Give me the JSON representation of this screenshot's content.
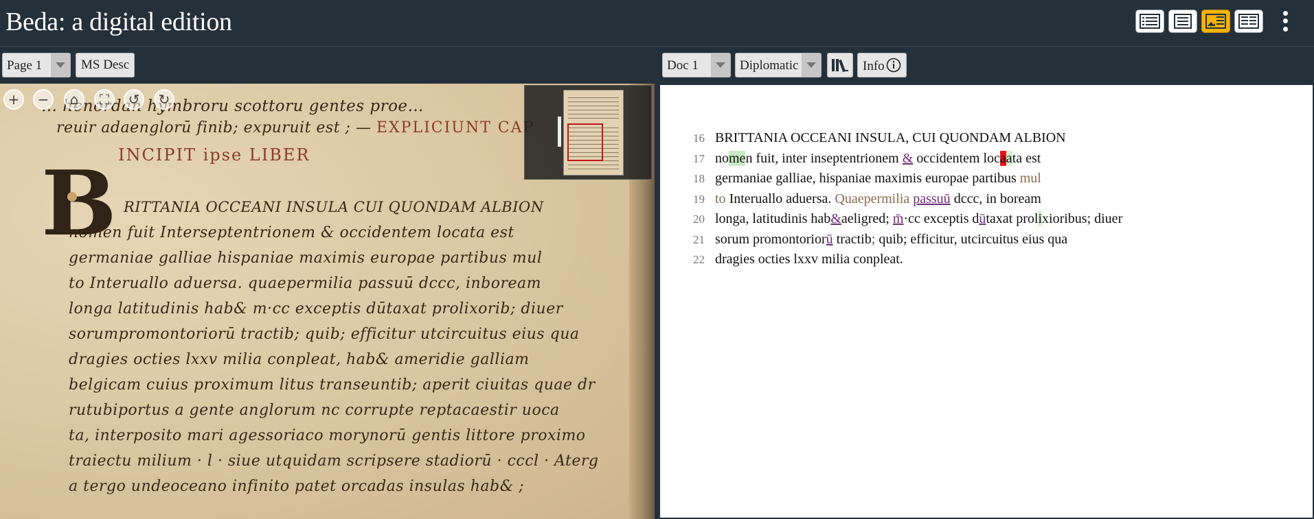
{
  "header": {
    "title": "Beda: a digital edition",
    "views": [
      {
        "name": "toc-view",
        "icon": "list-icon",
        "active": false
      },
      {
        "name": "text-view",
        "icon": "text-icon",
        "active": false
      },
      {
        "name": "image-text-view",
        "icon": "image-text-icon",
        "active": true
      },
      {
        "name": "text-text-view",
        "icon": "text-text-icon",
        "active": false
      }
    ],
    "more_icon": "kebab-menu-icon",
    "accent": "#f5b40a"
  },
  "left_toolbar": {
    "page_select": "Page 1",
    "ms_desc": "MS Desc"
  },
  "right_toolbar": {
    "doc_select": "Doc 1",
    "edition_select": "Diplomatic",
    "library_icon": "library-books-icon",
    "info_label": "Info",
    "info_icon": "info-circle-icon"
  },
  "viewer_controls": [
    "zoom-in-icon",
    "zoom-out-icon",
    "home-icon",
    "fullscreen-icon",
    "rotate-left-icon",
    "rotate-right-icon"
  ],
  "manuscript": {
    "line_a": "… henordan hymbroru scottoru gentes proe…",
    "line_b": "reuir adaenglorū finib; expuruit est ; — ",
    "line_b_rubric": "EXPLICIUNT CAP",
    "line_c": "INCIPIT  ipse LIBER",
    "initial": "B",
    "lines": [
      "RITTANIA OCCEANI INSULA CUI QUONDAM ALBION",
      "nomen fuit Interseptentrionem & occidentem locata est",
      "germaniae galliae hispaniae maximis europae partibus mul",
      "to Interuallo aduersa. quaepermilia passuū dccc, inboream",
      "longa latitudinis hab& m·cc  exceptis dūtaxat prolixorib; diuer",
      "sorumpromontoriorū tractib; quib; efficitur utcircuitus eius qua",
      "dragies octies lxxv milia conpleat, hab& ameridie galliam",
      "belgicam cuius proximum litus transeuntib; aperit ciuitas quae dr",
      "rutubiportus a gente anglorum nc corrupte reptacaestir uoca",
      "ta, interposito mari agessoriaco morynorū gentis littore proximo",
      "traiectu milium · l · siue utquidam scripsere stadiorū · cccl · Aterg",
      "a tergo undeoceano infinito patet orcadas insulas hab& ;"
    ]
  },
  "edition": {
    "lines": [
      {
        "n": "16",
        "segments": [
          {
            "t": "BRITTANIA OCCEANI INSULA, CUI QUONDAM ALBION",
            "c": ""
          }
        ]
      },
      {
        "n": "17",
        "segments": [
          {
            "t": "no",
            "c": ""
          },
          {
            "t": "me",
            "c": "hl-green"
          },
          {
            "t": "n fuit, inter inseptentrionem ",
            "c": ""
          },
          {
            "t": "&",
            "c": "abbr"
          },
          {
            "t": " occidentem loc",
            "c": ""
          },
          {
            "t": "a",
            "c": "hl-red"
          },
          {
            "t": "a",
            "c": "hl-lgreen"
          },
          {
            "t": "ta est",
            "c": ""
          }
        ]
      },
      {
        "n": "18",
        "segments": [
          {
            "t": "germaniae galliae, hispaniae maximis europae partibus ",
            "c": ""
          },
          {
            "t": "mul",
            "c": "mute"
          }
        ]
      },
      {
        "n": "19",
        "segments": [
          {
            "t": "to ",
            "c": "mute"
          },
          {
            "t": "Interuallo aduersa. ",
            "c": ""
          },
          {
            "t": "Quaepermilia ",
            "c": "mute"
          },
          {
            "t": "passuū",
            "c": "abbr"
          },
          {
            "t": " dccc, in boream",
            "c": ""
          }
        ]
      },
      {
        "n": "20",
        "segments": [
          {
            "t": "longa, latitudinis hab",
            "c": ""
          },
          {
            "t": "&",
            "c": "abbr"
          },
          {
            "t": "aeligred; ",
            "c": ""
          },
          {
            "t": "m̄",
            "c": "abbr"
          },
          {
            "t": "·cc exceptis d",
            "c": ""
          },
          {
            "t": "ū",
            "c": "abbr"
          },
          {
            "t": "taxat prol",
            "c": ""
          },
          {
            "t": "i",
            "c": "hl-lgreen"
          },
          {
            "t": "xioribus; diuer",
            "c": ""
          }
        ]
      },
      {
        "n": "21",
        "segments": [
          {
            "t": "sorum promontorior",
            "c": ""
          },
          {
            "t": "ū",
            "c": "abbr"
          },
          {
            "t": " tractib",
            "c": ""
          },
          {
            "t": ";",
            "c": "abbr"
          },
          {
            "t": " quib; efficitur, utcircuitus eius qua",
            "c": ""
          }
        ]
      },
      {
        "n": "22",
        "segments": [
          {
            "t": "dragies octies lxxv milia conpleat.",
            "c": ""
          }
        ]
      }
    ]
  }
}
